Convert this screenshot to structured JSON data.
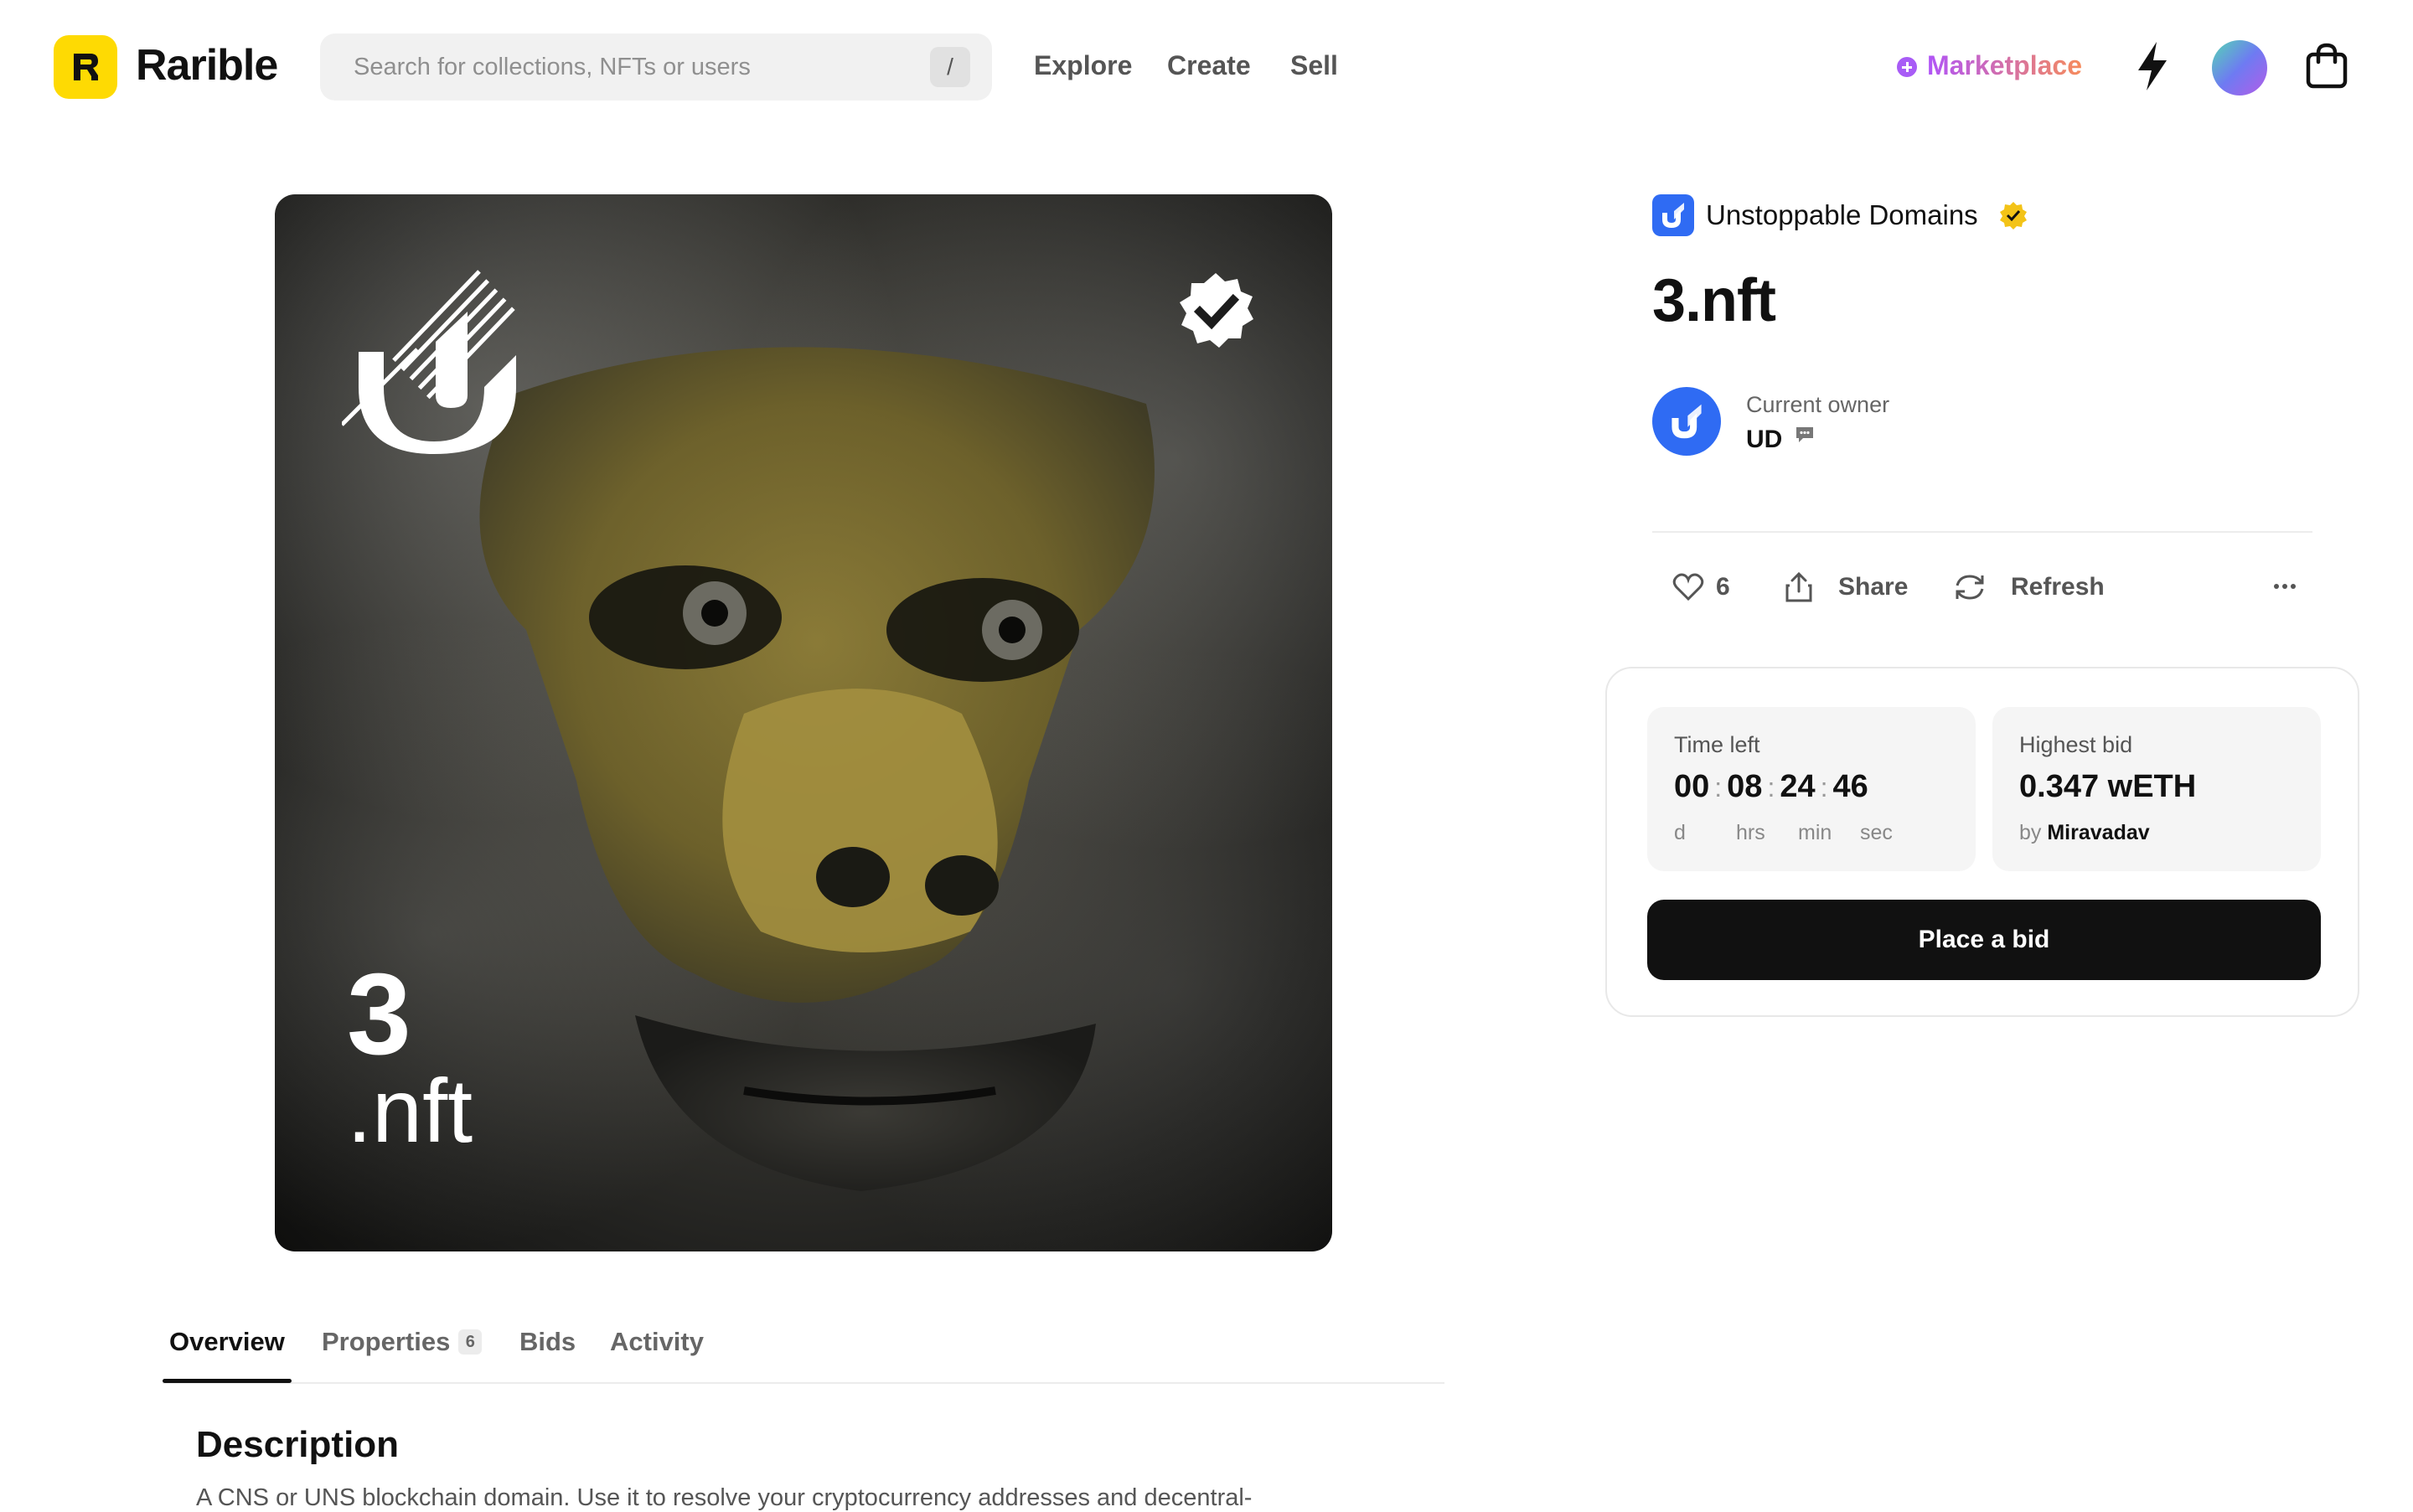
{
  "header": {
    "brand": "Rarible",
    "search": {
      "placeholder": "Search for collections, NFTs or users",
      "shortcut": "/"
    },
    "nav": [
      "Explore",
      "Create",
      "Sell"
    ],
    "marketplace_label": "Marketplace",
    "icons": [
      "lightning-icon",
      "user-avatar",
      "cart-icon"
    ]
  },
  "nft": {
    "image_text_number": "3",
    "image_text_ext": ".nft",
    "collection": "Unstoppable Domains",
    "title": "3.nft",
    "owner": {
      "label": "Current owner",
      "name": "UD"
    },
    "likes": "6",
    "share_label": "Share",
    "refresh_label": "Refresh"
  },
  "auction": {
    "time_left_label": "Time left",
    "time": {
      "d": "00",
      "hrs": "08",
      "min": "24",
      "sec": "46"
    },
    "units": {
      "d": "d",
      "hrs": "hrs",
      "min": "min",
      "sec": "sec"
    },
    "highest_bid_label": "Highest bid",
    "highest_bid_value": "0.347 wETH",
    "bidder_prefix": "by",
    "bidder": "Miravadav",
    "cta": "Place a bid"
  },
  "tabs": [
    {
      "label": "Overview",
      "active": true
    },
    {
      "label": "Properties",
      "badge": "6"
    },
    {
      "label": "Bids"
    },
    {
      "label": "Activity"
    }
  ],
  "description": {
    "title": "Description",
    "text": "A CNS or UNS blockchain domain. Use it to resolve your cryptocurrency addresses and decentral-"
  },
  "colors": {
    "brand_yellow": "#FEDA03",
    "ud_blue": "#2F6BF3",
    "marketplace_gradient": [
      "#B054F8",
      "#F68B5B"
    ],
    "cta_bg": "#111111"
  }
}
